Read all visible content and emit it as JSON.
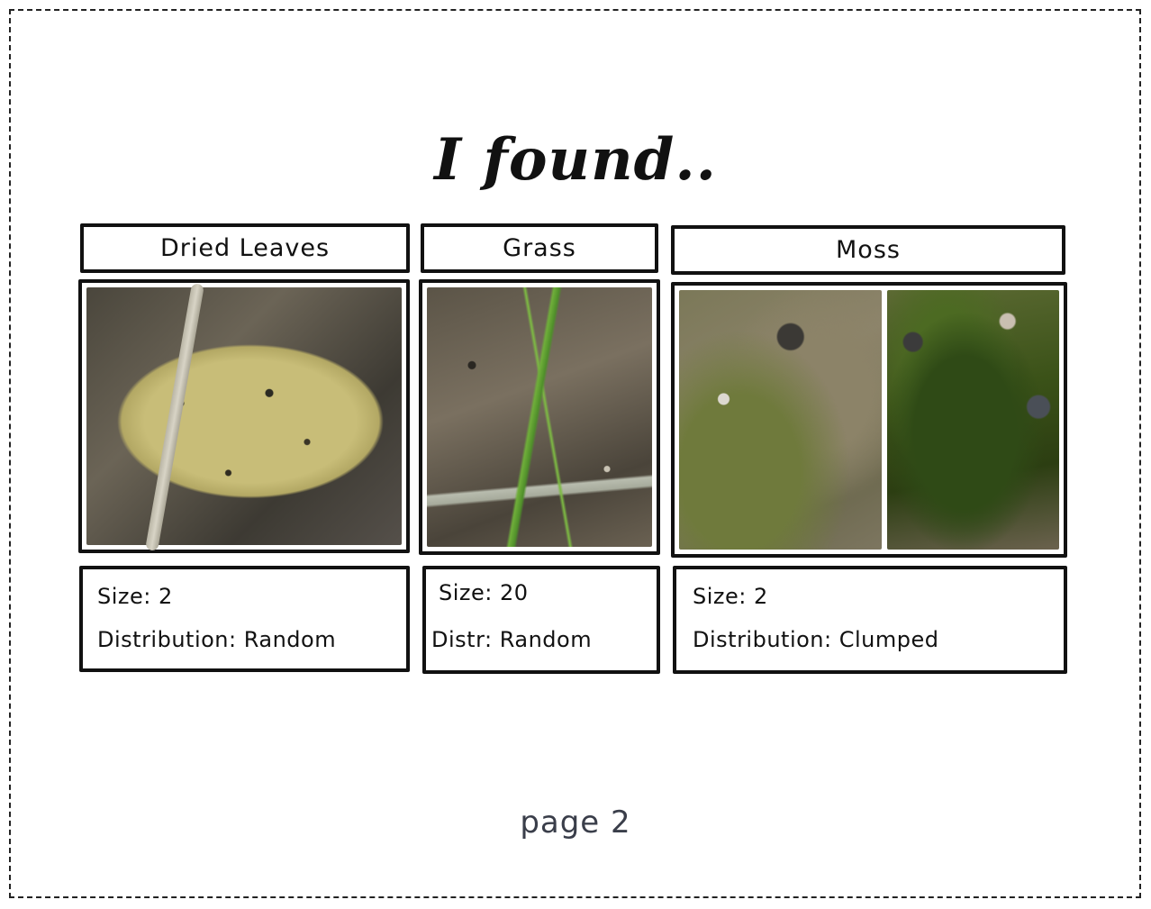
{
  "page": {
    "title": "I found..",
    "footer": "page 2"
  },
  "findings": [
    {
      "name": "Dried Leaves",
      "size_line": "Size: 2",
      "distribution_line": "Distribution: Random"
    },
    {
      "name": "Grass",
      "size_line": "Size: 20",
      "distribution_line": "Distr: Random"
    },
    {
      "name": "Moss",
      "size_line": "Size: 2",
      "distribution_line": "Distribution: Clumped"
    }
  ],
  "colors": {
    "ink": "#111111",
    "footer_text": "#3a3e4a",
    "background": "#ffffff"
  }
}
